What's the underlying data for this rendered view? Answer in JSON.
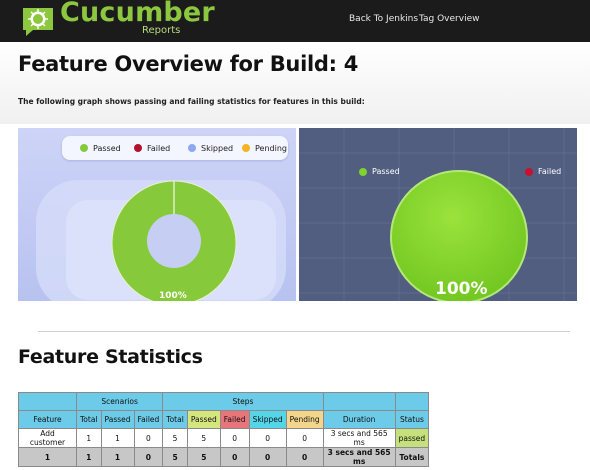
{
  "header": {
    "logo_name": "Cucumber",
    "logo_sub": "Reports",
    "nav": [
      "Back To Jenkins",
      "Tag Overview"
    ],
    "colors": {
      "bar": "#1b1b1b",
      "brand": "#8dc63f"
    }
  },
  "page": {
    "title": "Feature Overview for Build: 4",
    "description": "The following graph shows passing and failing statistics for features in this build:"
  },
  "charts": {
    "left_legend": [
      {
        "label": "Passed",
        "color": "#88c93a"
      },
      {
        "label": "Failed",
        "color": "#b3122e"
      },
      {
        "label": "Skipped",
        "color": "#8ea8ef"
      },
      {
        "label": "Pending",
        "color": "#f5b324"
      }
    ],
    "left_percent": "100%",
    "right_legend": [
      {
        "label": "Passed",
        "color": "#7fd12c"
      },
      {
        "label": "Failed",
        "color": "#c41230"
      }
    ],
    "right_percent": "100%"
  },
  "stats": {
    "title": "Feature Statistics",
    "group_headers": [
      "Scenarios",
      "Steps"
    ],
    "columns": [
      "Feature",
      "Total",
      "Passed",
      "Failed",
      "Total",
      "Passed",
      "Failed",
      "Skipped",
      "Pending",
      "Duration",
      "Status"
    ],
    "rows": [
      [
        "Add customer",
        "1",
        "1",
        "0",
        "5",
        "5",
        "0",
        "0",
        "0",
        "3 secs and 565 ms",
        "passed"
      ]
    ],
    "totals": [
      "1",
      "1",
      "1",
      "0",
      "5",
      "5",
      "0",
      "0",
      "0",
      "3 secs and 565 ms",
      "Totals"
    ]
  },
  "chart_data": [
    {
      "type": "pie",
      "categories": [
        "Passed",
        "Failed",
        "Skipped",
        "Pending"
      ],
      "values": [
        100,
        0,
        0,
        0
      ],
      "data_label": "100%",
      "style": "donut",
      "legend": "top"
    },
    {
      "type": "pie",
      "categories": [
        "Passed",
        "Failed"
      ],
      "values": [
        100,
        0
      ],
      "data_label": "100%",
      "legend": "top"
    }
  ]
}
